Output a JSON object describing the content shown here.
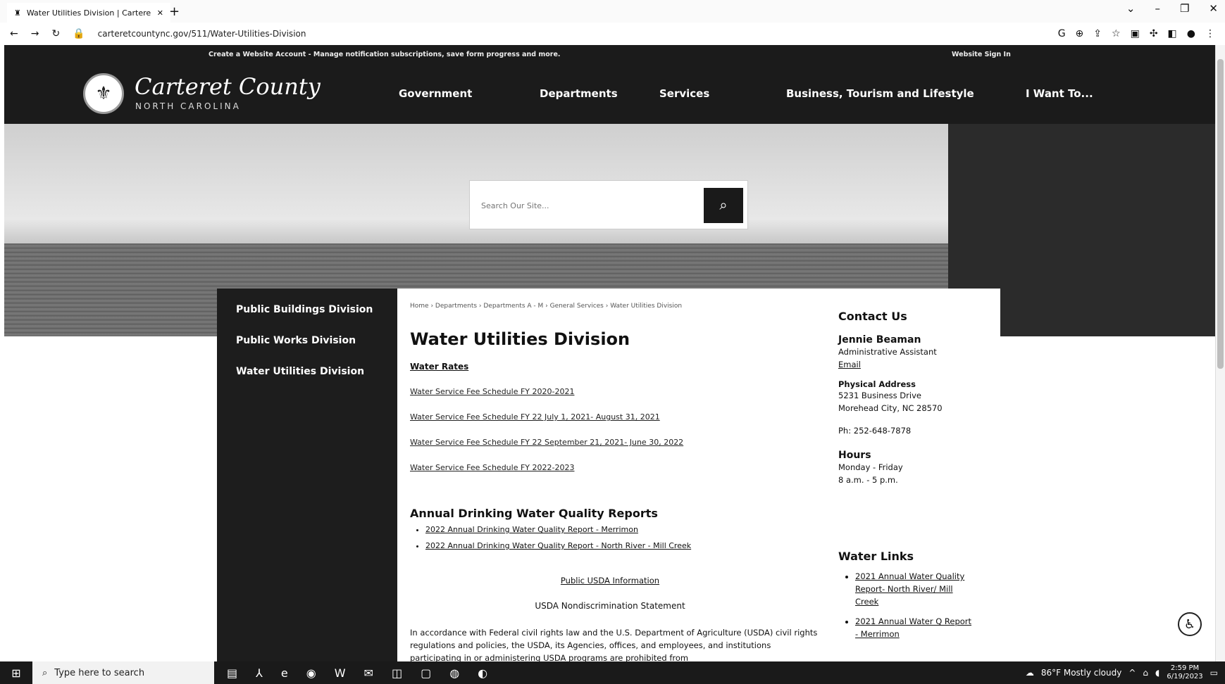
{
  "browser": {
    "tab_title": "Water Utilities Division | Cartere",
    "url": "carteretcountync.gov/511/Water-Utilities-Division"
  },
  "header": {
    "top_message": "Create a Website Account - Manage notification subscriptions, save form progress and more.",
    "sign_in": "Website Sign In",
    "logo_name": "Carteret County",
    "logo_sub": "NORTH CAROLINA",
    "nav": [
      "Government",
      "Departments",
      "Services",
      "Business, Tourism and Lifestyle",
      "I Want To..."
    ]
  },
  "search": {
    "placeholder": "Search Our Site..."
  },
  "sidenav": [
    "Public Buildings Division",
    "Public Works Division",
    "Water Utilities Division"
  ],
  "main": {
    "breadcrumb": "Home › Departments › Departments A - M › General Services › Water Utilities Division",
    "title": "Water Utilities Division",
    "rates_title": "Water Rates",
    "fee_links": [
      "Water Service Fee Schedule FY 2020-2021",
      "Water Service Fee Schedule FY 22 July 1, 2021- August 31, 2021",
      "Water Service Fee Schedule FY 22 September 21, 2021- June 30, 2022",
      "Water Service Fee Schedule FY 2022-2023"
    ],
    "reports_title": "Annual Drinking Water Quality Reports",
    "reports": [
      "2022 Annual Drinking Water Quality Report - Merrimon",
      "2022 Annual Drinking Water Quality Report - North River - Mill Creek"
    ],
    "usda_link": "Public USDA Information",
    "usda_statement": "USDA Nondiscrimination Statement",
    "usda_paragraph": "In accordance with Federal civil rights law and the U.S. Department of Agriculture (USDA) civil rights regulations and policies, the USDA, its Agencies, offices, and employees, and institutions participating in or administering USDA programs are prohibited from"
  },
  "contact": {
    "heading": "Contact Us",
    "name": "Jennie Beaman",
    "role": "Administrative Assistant",
    "email": "Email",
    "address_label": "Physical Address",
    "address_line1": "5231 Business Drive",
    "address_line2": "Morehead City, NC 28570",
    "phone": "Ph: 252-648-7878",
    "hours_label": "Hours",
    "hours_days": "Monday - Friday",
    "hours_time": "8 a.m. - 5 p.m.",
    "links_heading": "Water Links",
    "links": [
      "2021 Annual Water Quality Report- North River/ Mill Creek",
      "2021 Annual Water Q Report - Merrimon"
    ]
  },
  "taskbar": {
    "search_placeholder": "Type here to search",
    "weather": "86°F  Mostly cloudy",
    "time": "2:59 PM",
    "date": "6/19/2023"
  }
}
